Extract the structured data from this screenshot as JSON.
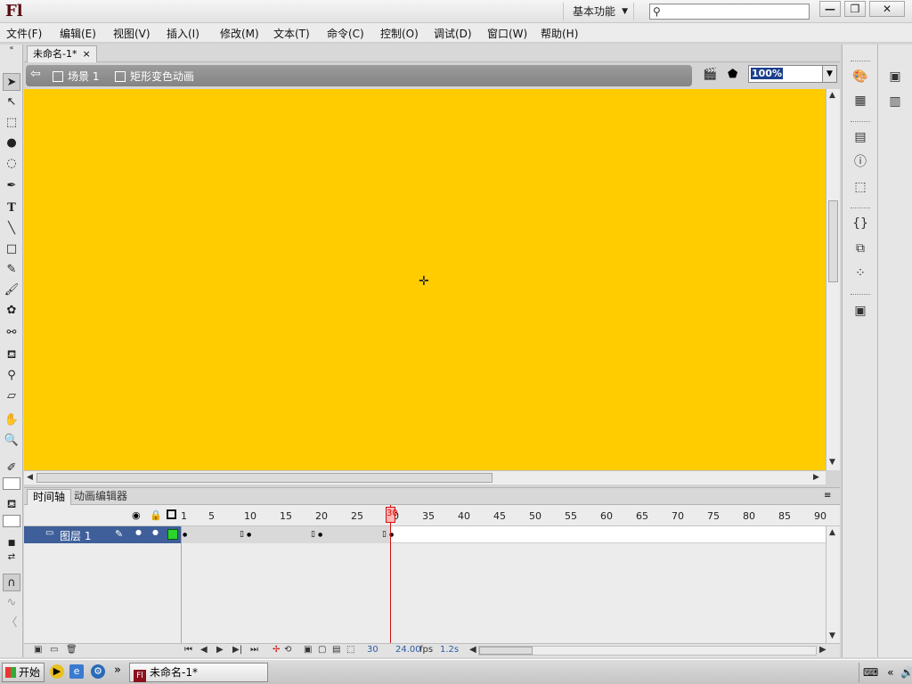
{
  "app": {
    "logo": "Fl",
    "workspace": "基本功能"
  },
  "window_controls": {
    "minimize": "—",
    "restore": "❐",
    "close": "✕"
  },
  "menu": [
    {
      "label": "文件(F)"
    },
    {
      "label": "编辑(E)"
    },
    {
      "label": "视图(V)"
    },
    {
      "label": "插入(I)"
    },
    {
      "label": "修改(M)"
    },
    {
      "label": "文本(T)"
    },
    {
      "label": "命令(C)"
    },
    {
      "label": "控制(O)"
    },
    {
      "label": "调试(D)"
    },
    {
      "label": "窗口(W)"
    },
    {
      "label": "帮助(H)"
    }
  ],
  "search": {
    "value": "",
    "placeholder": ""
  },
  "document": {
    "tab_title": "未命名-1*",
    "scene": "场景 1",
    "symbol": "矩形变色动画",
    "zoom": "100%"
  },
  "stage": {
    "color": "#ffcc00"
  },
  "timeline": {
    "tabs": [
      "时间轴",
      "动画编辑器"
    ],
    "frame_numbers": [
      "1",
      "5",
      "10",
      "15",
      "20",
      "25",
      "30",
      "35",
      "40",
      "45",
      "50",
      "55",
      "60",
      "65",
      "70",
      "75",
      "80",
      "85",
      "90"
    ],
    "layer_name": "图层 1",
    "current_frame": 30,
    "footer": {
      "frame": "30",
      "fps": "24.00",
      "fps_unit": "fps",
      "time": "1.2s"
    }
  },
  "taskbar": {
    "start_label": "开始",
    "window_label": "未命名-1*"
  },
  "colors": {
    "accent": "#3e5f99",
    "playhead": "#d01010",
    "brand": "#8b0f1d"
  }
}
